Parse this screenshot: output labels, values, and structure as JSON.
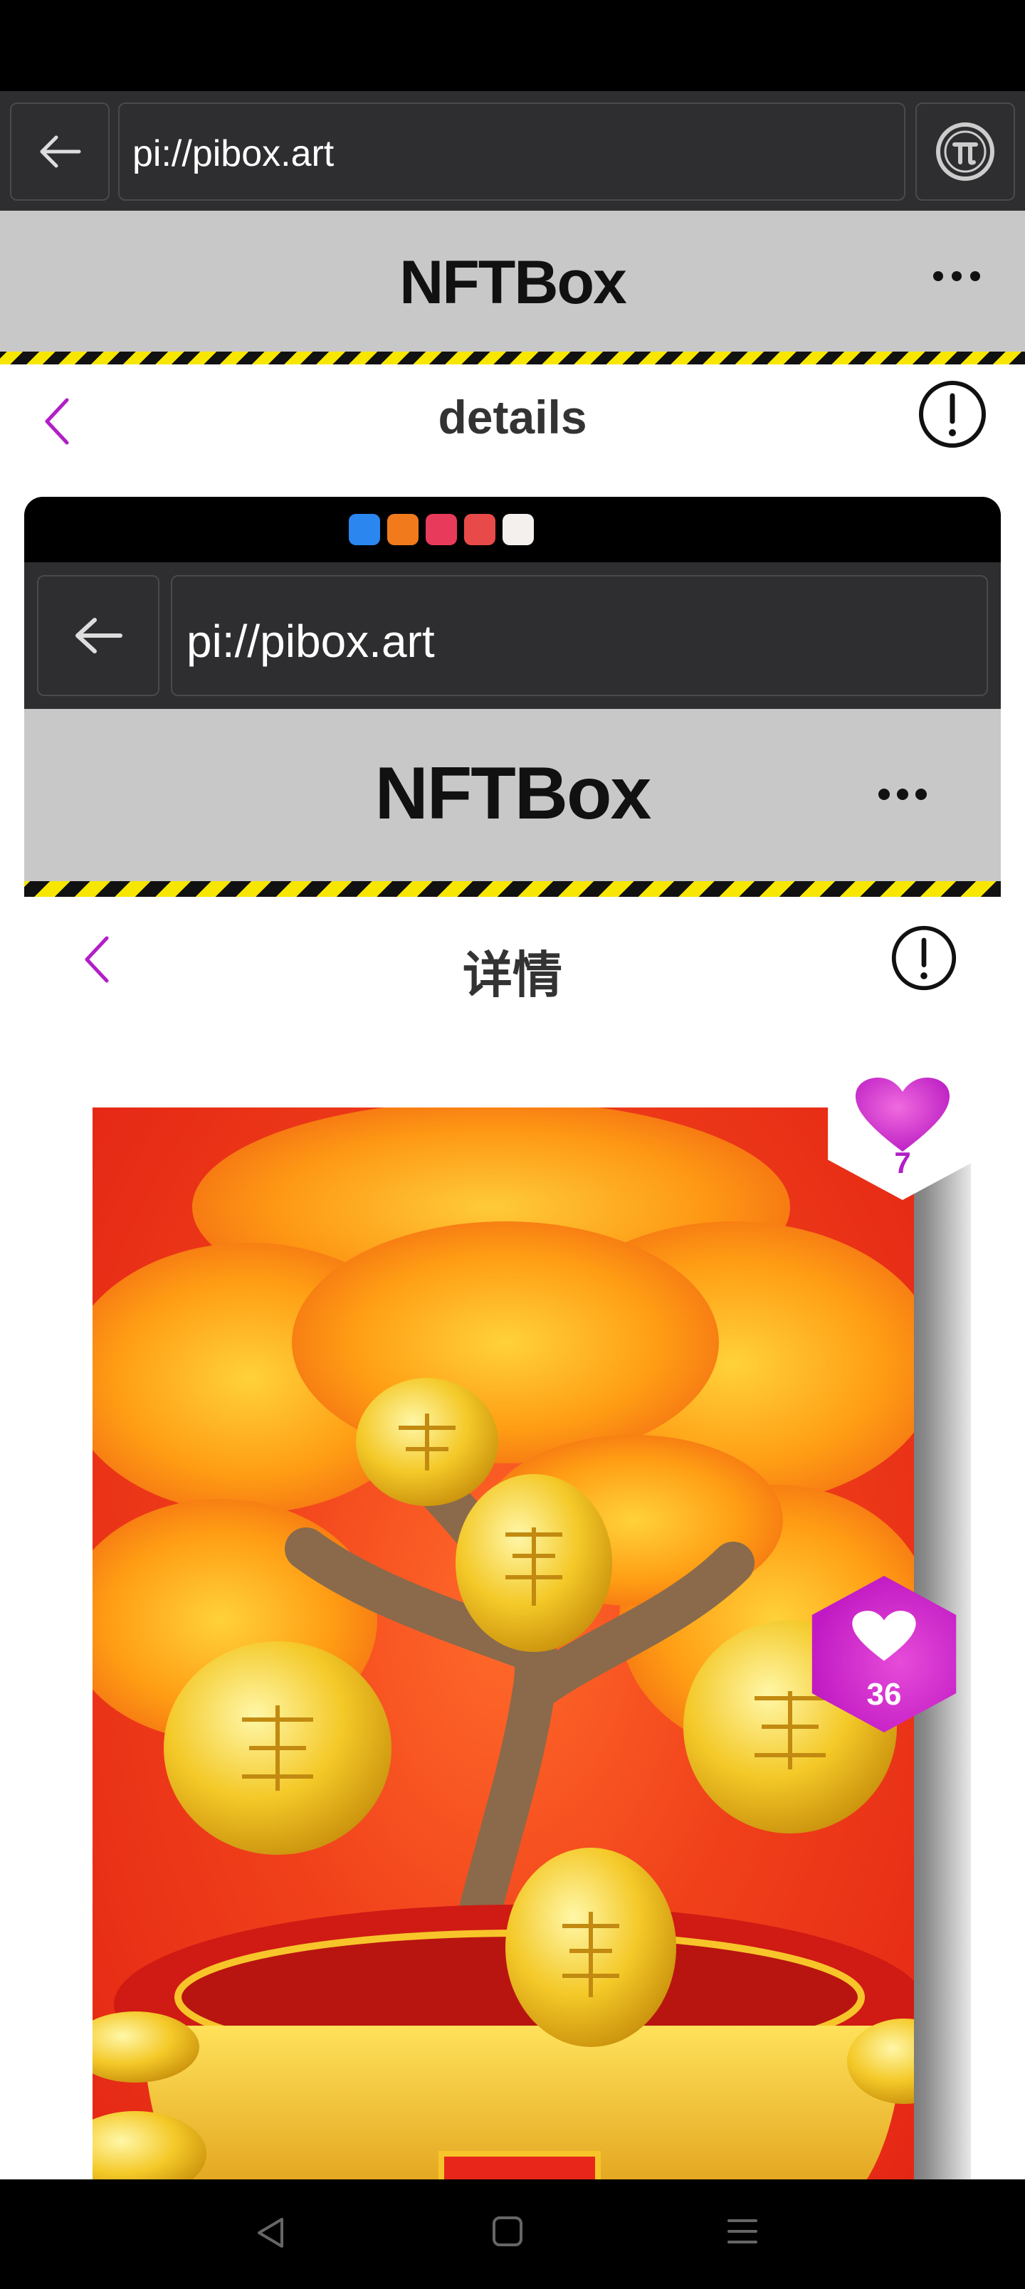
{
  "browser": {
    "url": "pi://pibox.art"
  },
  "app": {
    "title": "NFTBox"
  },
  "details": {
    "title": "details"
  },
  "screenshot": {
    "browser_url": "pi://pibox.art",
    "app_title": "NFTBox",
    "details_title": "详情",
    "like_count": "7",
    "artwork_like_count": "36"
  },
  "colors": {
    "accent": "#c11ac4",
    "header_gray": "#c8c8c8",
    "browser_dark": "#2e2e30",
    "hazard_yellow": "#f7e600"
  },
  "icons": {
    "back": "arrow-left-icon",
    "pi": "pi-network-icon",
    "more": "more-dots-icon",
    "details_back": "chevron-left-icon",
    "info": "info-circle-icon",
    "heart": "heart-icon",
    "nav_back": "nav-back-icon",
    "nav_home": "nav-home-icon",
    "nav_menu": "nav-menu-icon"
  }
}
